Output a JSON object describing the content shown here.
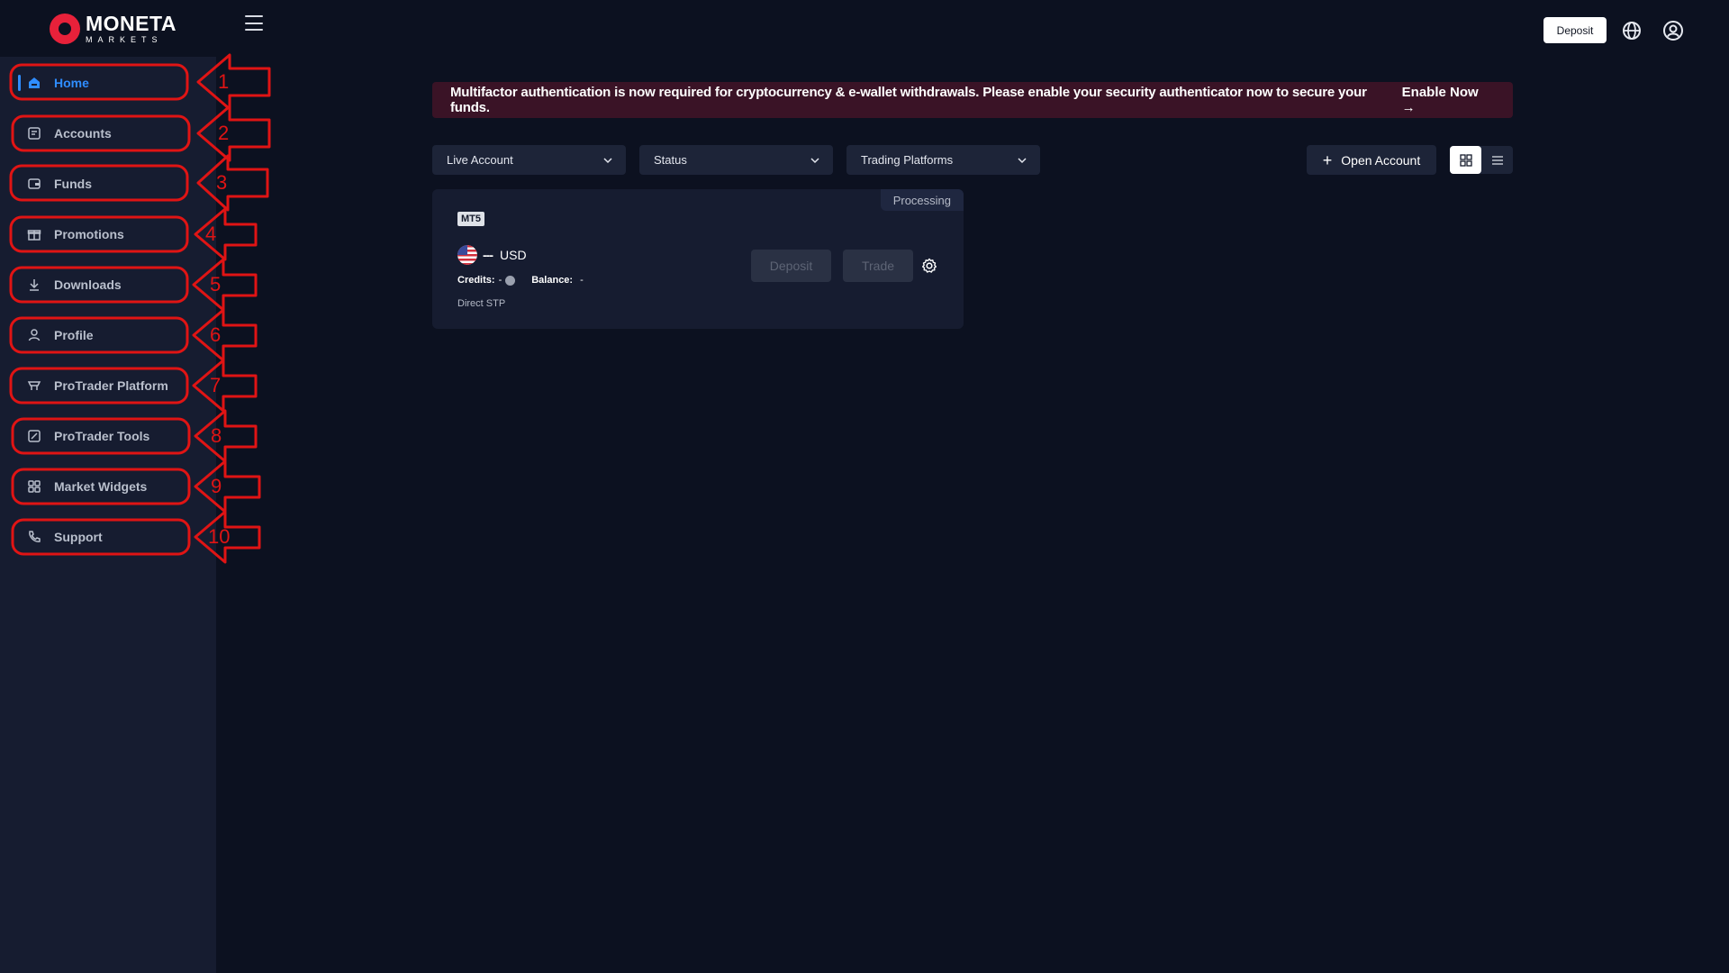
{
  "brand": {
    "name": "MONETA",
    "sub": "MARKETS"
  },
  "sidebar": {
    "items": [
      {
        "label": "Home",
        "icon": "home-icon"
      },
      {
        "label": "Accounts",
        "icon": "accounts-icon"
      },
      {
        "label": "Funds",
        "icon": "wallet-icon"
      },
      {
        "label": "Promotions",
        "icon": "gift-icon"
      },
      {
        "label": "Downloads",
        "icon": "download-icon"
      },
      {
        "label": "Profile",
        "icon": "user-icon"
      },
      {
        "label": "ProTrader Platform",
        "icon": "platform-icon"
      },
      {
        "label": "ProTrader Tools",
        "icon": "chart-icon"
      },
      {
        "label": "Market Widgets",
        "icon": "grid-icon"
      },
      {
        "label": "Support",
        "icon": "phone-icon"
      }
    ]
  },
  "annotations": [
    "1",
    "2",
    "3",
    "4",
    "5",
    "6",
    "7",
    "8",
    "9",
    "10"
  ],
  "topbar": {
    "deposit_label": "Deposit"
  },
  "banner": {
    "text": "Multifactor authentication is now required for cryptocurrency & e-wallet withdrawals. Please enable your security authenticator now to secure your funds.",
    "link": "Enable Now →"
  },
  "filters": {
    "account_type": "Live Account",
    "status": "Status",
    "platforms": "Trading Platforms"
  },
  "open_account_label": "Open Account",
  "card": {
    "status": "Processing",
    "platform": "MT5",
    "account_number": "---",
    "currency": "USD",
    "credits_label": "Credits:",
    "credits_value": "-",
    "balance_label": "Balance:",
    "balance_value": "-",
    "account_kind": "Direct STP",
    "deposit_label": "Deposit",
    "trade_label": "Trade"
  },
  "colors": {
    "accent": "#2f8dff",
    "annotation": "#e01414",
    "brand": "#e8213a",
    "banner_bg": "#3a1326"
  }
}
